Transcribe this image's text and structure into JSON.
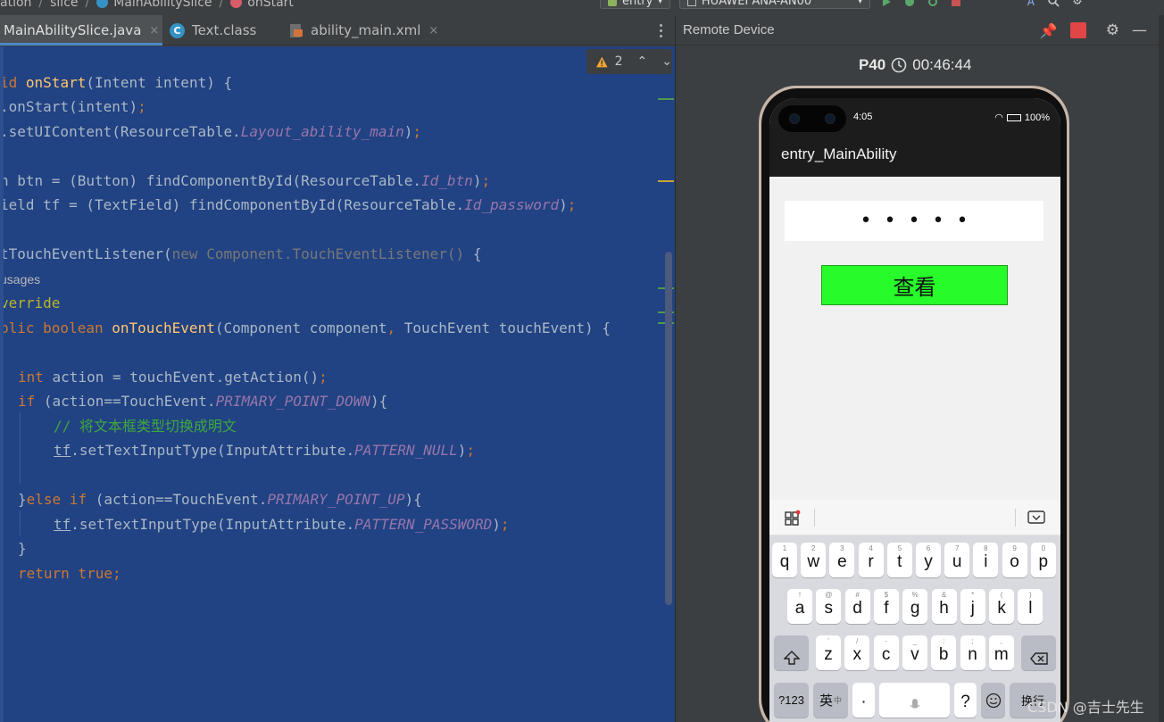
{
  "breadcrumb": {
    "items": [
      "ation",
      "slice",
      "MainAbilitySlice",
      "onStart"
    ]
  },
  "run_config": {
    "module": "entry",
    "device": "HUAWEI ANA-AN00"
  },
  "tabs": [
    {
      "label": "MainAbilitySlice.java",
      "active": true
    },
    {
      "label": "Text.class",
      "active": false
    },
    {
      "label": "ability_main.xml",
      "active": false
    }
  ],
  "tab_close_glyph": "×",
  "inspection": {
    "warnings": "2"
  },
  "code": {
    "l1_a": "id ",
    "l1_fn": "onStart",
    "l1_b": "(Intent intent) {",
    "l2_a": ".onStart(intent)",
    "l2_b": ";",
    "l3_a": ".setUIContent(ResourceTable.",
    "l3_it": "Layout_ability_main",
    "l3_b": ")",
    "l3_c": ";",
    "l4_a": "n btn = (Button) findComponentById(ResourceTable.",
    "l4_it": "Id_btn",
    "l4_b": ")",
    "l4_c": ";",
    "l5_a": "ield tf = (TextField) findComponentById(ResourceTable.",
    "l5_it": "Id_password",
    "l5_b": ")",
    "l5_c": ";",
    "l6_a": "tTouchEventListener(",
    "l6_dim": "new Component.TouchEventListener() ",
    "l6_b": "{",
    "l7_hint": "usages",
    "l8_an": "verride",
    "l9_kw": "blic boolean ",
    "l9_fn": "onTouchEvent",
    "l9_a": "(Component component",
    "l9_comma": ",",
    "l9_b": " TouchEvent touchEvent) {",
    "l10_kw": "int",
    "l10_a": " action = touchEvent.getAction()",
    "l10_b": ";",
    "l11_kw": "if",
    "l11_a": " (action==TouchEvent.",
    "l11_it": "PRIMARY_POINT_DOWN",
    "l11_b": "){",
    "l12_cm": "// 将文本框类型切换成明文",
    "l13_ul": "tf",
    "l13_a": ".setTextInputType(InputAttribute.",
    "l13_it": "PATTERN_NULL",
    "l13_b": ")",
    "l13_c": ";",
    "l14_a": "}",
    "l14_kw": "else if",
    "l14_b": " (action==TouchEvent.",
    "l14_it": "PRIMARY_POINT_UP",
    "l14_c": "){",
    "l15_ul": "tf",
    "l15_a": ".setTextInputType(InputAttribute.",
    "l15_it": "PATTERN_PASSWORD",
    "l15_b": ")",
    "l15_c": ";",
    "l16_a": "}",
    "l17_kw": "return true",
    "l17_b": ";"
  },
  "remote": {
    "title": "Remote Device",
    "device_name": "P40",
    "timer": "00:46:44"
  },
  "phone": {
    "status_time": "4:05",
    "battery": "100%",
    "app_title": "entry_MainAbility",
    "password_mask": "•••••",
    "button_label": "查看",
    "keyboard": {
      "row1": [
        {
          "k": "q",
          "s": "1"
        },
        {
          "k": "w",
          "s": "2"
        },
        {
          "k": "e",
          "s": "3"
        },
        {
          "k": "r",
          "s": "4"
        },
        {
          "k": "t",
          "s": "5"
        },
        {
          "k": "y",
          "s": "6"
        },
        {
          "k": "u",
          "s": "7"
        },
        {
          "k": "i",
          "s": "8"
        },
        {
          "k": "o",
          "s": "9"
        },
        {
          "k": "p",
          "s": "0"
        }
      ],
      "row2": [
        {
          "k": "a",
          "s": "!"
        },
        {
          "k": "s",
          "s": "@"
        },
        {
          "k": "d",
          "s": "#"
        },
        {
          "k": "f",
          "s": "$"
        },
        {
          "k": "g",
          "s": "%"
        },
        {
          "k": "h",
          "s": "&"
        },
        {
          "k": "j",
          "s": "*"
        },
        {
          "k": "k",
          "s": "("
        },
        {
          "k": "l",
          "s": ")"
        }
      ],
      "row3": [
        {
          "k": "z",
          "s": "'"
        },
        {
          "k": "x",
          "s": "/"
        },
        {
          "k": "c",
          "s": "-"
        },
        {
          "k": "v",
          "s": "_"
        },
        {
          "k": "b",
          "s": ":"
        },
        {
          "k": "n",
          "s": ";"
        },
        {
          "k": "m",
          "s": ","
        }
      ],
      "sym_key": "?123",
      "lang_key": "英",
      "lang_sub": "中",
      "dot_key": "·",
      "question_key": "?",
      "enter_key": "换行"
    }
  },
  "watermark": "CSDN @吉士先生",
  "colors": {
    "editor_bg": "#214283",
    "keyword": "#cc7832",
    "function": "#ffc66d",
    "constant": "#9876aa",
    "comment": "#3ea83e",
    "view_button": "#27fc2a"
  }
}
